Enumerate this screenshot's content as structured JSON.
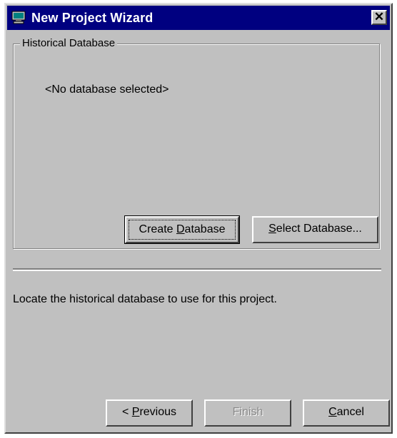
{
  "window": {
    "title": "New Project Wizard",
    "close_glyph": "✕",
    "app_icon": "computer-icon"
  },
  "group": {
    "label": "Historical Database",
    "status_text": "<No database selected>"
  },
  "buttons": {
    "create_database": {
      "pre": "Create ",
      "mnemonic": "D",
      "post": "atabase"
    },
    "select_database": {
      "pre": "",
      "mnemonic": "S",
      "post": "elect Database..."
    },
    "previous": {
      "pre": "< ",
      "mnemonic": "P",
      "post": "revious"
    },
    "finish": {
      "label": "Finish",
      "enabled": false
    },
    "cancel": {
      "pre": "",
      "mnemonic": "C",
      "post": "ancel"
    }
  },
  "description": "Locate the historical database to use for this project.",
  "colors": {
    "titlebar": "#000080",
    "face": "#c0c0c0",
    "shadow": "#808080",
    "highlight": "#ffffff"
  }
}
